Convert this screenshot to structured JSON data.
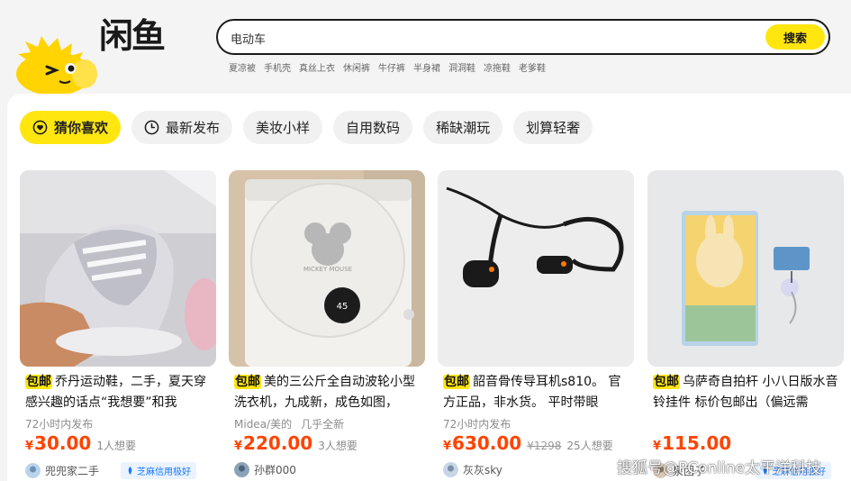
{
  "header": {
    "logo_text": "闲鱼",
    "search": {
      "value": "电动车",
      "button_label": "搜索"
    },
    "hot_words": [
      "夏凉被",
      "手机壳",
      "真丝上衣",
      "休闲裤",
      "牛仔裤",
      "半身裙",
      "洞洞鞋",
      "凉拖鞋",
      "老爹鞋"
    ]
  },
  "tabs": [
    {
      "label": "猜你喜欢",
      "icon": "heart-circle-icon",
      "active": true
    },
    {
      "label": "最新发布",
      "icon": "clock-icon",
      "active": false
    },
    {
      "label": "美妆小样"
    },
    {
      "label": "自用数码"
    },
    {
      "label": "稀缺潮玩"
    },
    {
      "label": "划算轻奢"
    }
  ],
  "cards": [
    {
      "badge": "包邮",
      "title": "乔丹运动鞋，二手，夏天穿 感兴趣的话点“我想要”和我",
      "sub": "72小时内发布",
      "currency": "¥",
      "price": "30.00",
      "want": "1人想要",
      "seller": "兜兜家二手",
      "credit": "芝麻信用极好"
    },
    {
      "badge": "包邮",
      "title": "美的三公斤全自动波轮小型洗衣机，九成新，成色如图，",
      "sub": "Midea/美的",
      "sub_tag": "几乎全新",
      "currency": "¥",
      "price": "220.00",
      "want": "3人想要",
      "seller": "孙群000"
    },
    {
      "badge": "包邮",
      "title": "韶音骨传导耳机s810。 官方正品，非水货。 平时带眼",
      "sub": "72小时内发布",
      "currency": "¥",
      "price": "630.00",
      "orig": "¥1298",
      "want": "25人想要",
      "seller": "灰灰sky"
    },
    {
      "badge": "包邮",
      "title": "乌萨奇自拍杆 小八日版水音铃挂件 标价包邮出（偏远需",
      "currency": "¥",
      "price": "115.00",
      "seller": "泉团子",
      "credit": "芝麻信用极好"
    }
  ],
  "watermark": "搜狐号@PConline太平洋科技",
  "colors": {
    "accent": "#ffe60f",
    "price": "#ff4400",
    "credit": "#1677ff"
  }
}
